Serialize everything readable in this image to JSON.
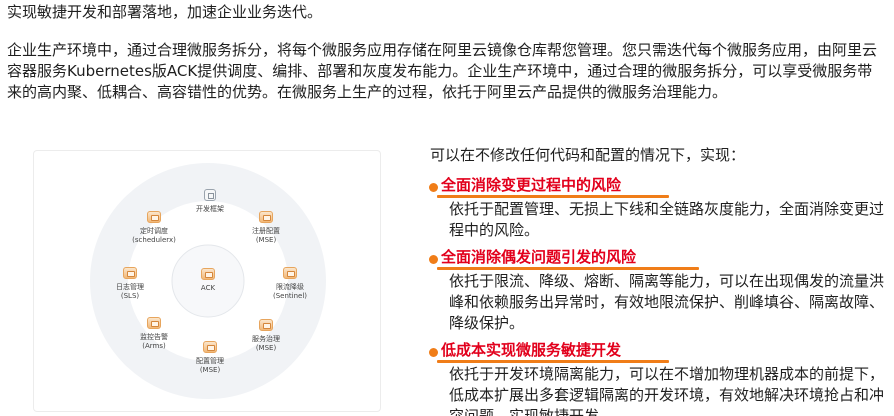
{
  "intro": {
    "title": "实现敏捷开发和部署落地，加速企业业务迭代。",
    "paragraph": "企业生产环境中，通过合理微服务拆分，将每个微服务应用存储在阿里云镜像仓库帮您管理。您只需迭代每个微服务应用，由阿里云容器服务Kubernetes版ACK提供调度、编排、部署和灰度发布能力。企业生产环境中，通过合理的微服务拆分，可以享受微服务带来的高内聚、低耦合、高容错性的优势。在微服务上生产的过程，依托于阿里云产品提供的微服务治理能力。"
  },
  "diagram": {
    "center": {
      "label": "ACK",
      "icon": "cube-icon"
    },
    "nodes": [
      {
        "label": "开发框架",
        "sub": "",
        "icon": "box-icon"
      },
      {
        "label": "注册配置",
        "sub": "(MSE)",
        "icon": "cube-icon"
      },
      {
        "label": "限流降级",
        "sub": "(Sentinel)",
        "icon": "cube-icon"
      },
      {
        "label": "服务治理",
        "sub": "(MSE)",
        "icon": "cube-icon"
      },
      {
        "label": "配置管理",
        "sub": "(MSE)",
        "icon": "cube-icon"
      },
      {
        "label": "监控告警",
        "sub": "(Arms)",
        "icon": "cube-icon"
      },
      {
        "label": "日志管理",
        "sub": "(SLS)",
        "icon": "cube-icon"
      },
      {
        "label": "定时调度",
        "sub": "(schedulerx)",
        "icon": "cube-icon"
      }
    ]
  },
  "right": {
    "lead": "可以在不修改任何代码和配置的情况下，实现：",
    "features": [
      {
        "title": "全面消除变更过程中的风险",
        "desc": "依托于配置管理、无损上下线和全链路灰度能力，全面消除变更过程中的风险。"
      },
      {
        "title": "全面消除偶发问题引发的风险",
        "desc": "依托于限流、降级、熔断、隔离等能力，可以在出现偶发的流量洪峰和依赖服务出异常时，有效地限流保护、削峰填谷、隔离故障、降级保护。"
      },
      {
        "title": "低成本实现微服务敏捷开发",
        "desc": "依托于开发环境隔离能力，可以在不增加物理机器成本的前提下，低成本扩展出多套逻辑隔离的开发环境，有效地解决环境抢占和冲突问题，实现敏捷开发。"
      }
    ],
    "accent_color": "#f07d18",
    "title_color": "#e2001c"
  }
}
